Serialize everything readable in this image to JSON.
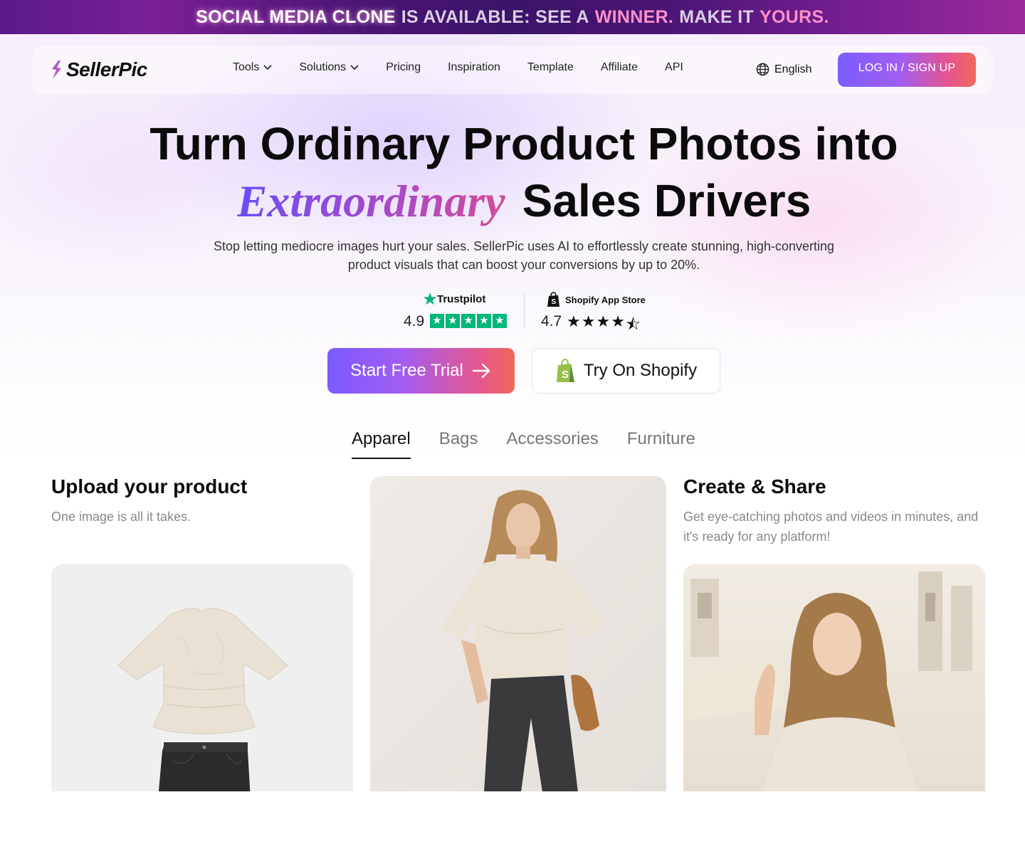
{
  "banner": {
    "part1": "SOCIAL MEDIA CLONE",
    "part2": "IS AVAILABLE: SEE A",
    "part3": "WINNER.",
    "part4": "MAKE IT",
    "part5": "YOURS."
  },
  "nav": {
    "logo": "SellerPic",
    "links": [
      "Tools",
      "Solutions",
      "Pricing",
      "Inspiration",
      "Template",
      "Affiliate",
      "API"
    ],
    "language": "English",
    "login": "LOG IN / SIGN UP"
  },
  "hero": {
    "title_line1": "Turn Ordinary Product Photos into",
    "title_highlight": "Extraordinary",
    "title_rest": "Sales Drivers",
    "subtitle": "Stop letting mediocre images hurt your sales. SellerPic uses AI to effortlessly create stunning, high-converting product visuals that can boost your conversions by up to 20%."
  },
  "ratings": {
    "trustpilot": {
      "name": "Trustpilot",
      "score": "4.9",
      "stars": 5
    },
    "shopify": {
      "name": "Shopify App Store",
      "score": "4.7",
      "stars": 4.5
    }
  },
  "cta": {
    "trial": "Start Free Trial",
    "shopify": "Try On Shopify"
  },
  "tabs": {
    "items": [
      "Apparel",
      "Bags",
      "Accessories",
      "Furniture"
    ],
    "active": "Apparel"
  },
  "steps": {
    "upload_title": "Upload your product",
    "upload_desc": "One image is all it takes.",
    "share_title": "Create & Share",
    "share_desc": "Get eye-catching photos and videos in minutes, and it's ready for any platform!"
  },
  "colors": {
    "accent_start": "#7b5cff",
    "accent_end": "#f06a5a",
    "trustpilot_green": "#00b67a",
    "shopify_green": "#95bf47"
  }
}
